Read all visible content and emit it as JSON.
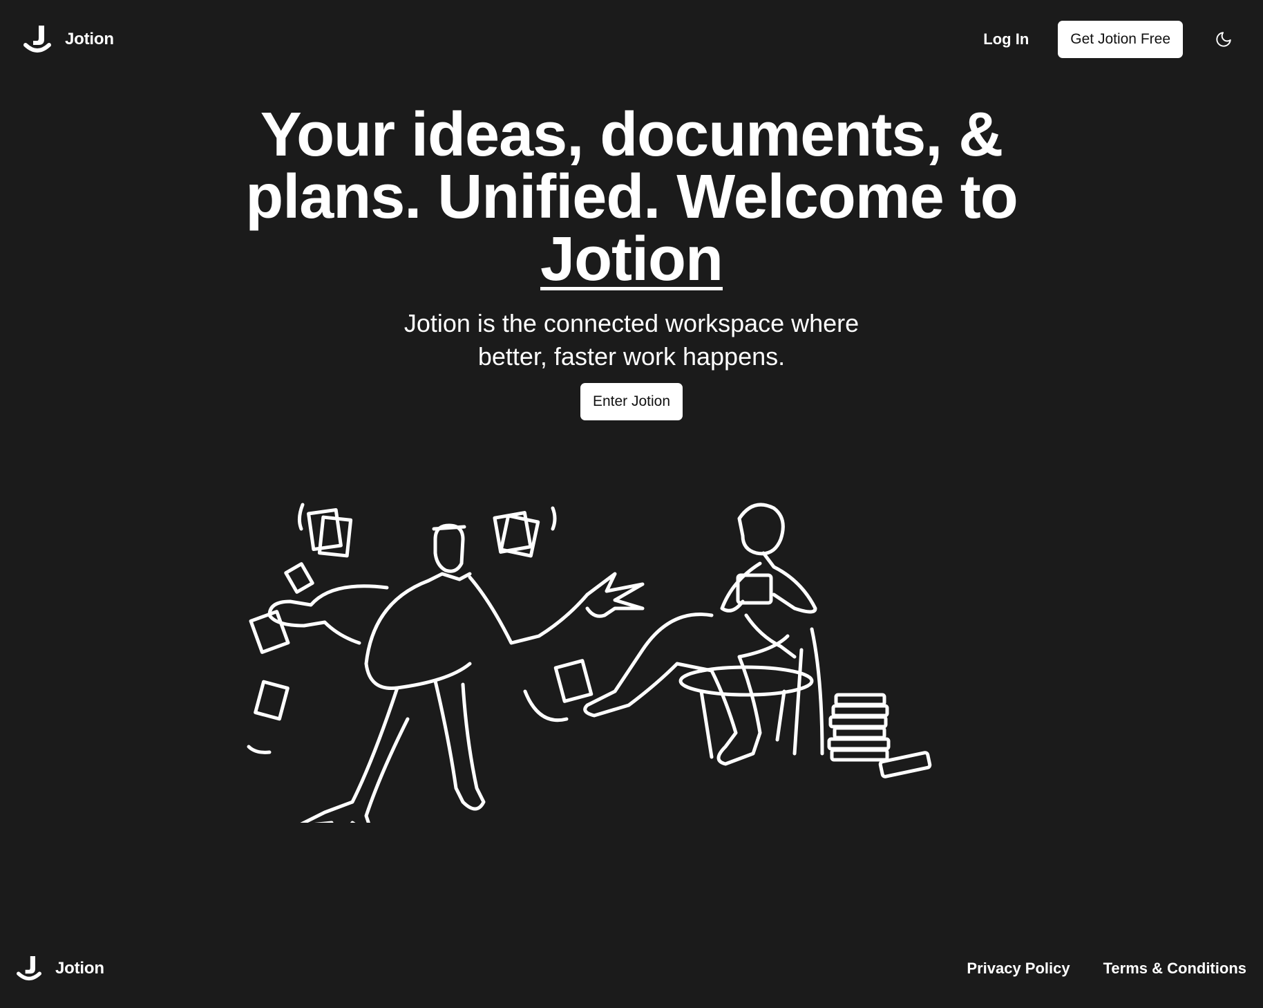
{
  "header": {
    "brand_name": "Jotion",
    "login_label": "Log In",
    "cta_label": "Get Jotion Free",
    "theme_icon": "moon-icon"
  },
  "hero": {
    "title_part1": "Your ideas, documents, & plans. Unified. Welcome to ",
    "title_brand": "Jotion",
    "subtitle": "Jotion is the connected workspace where better, faster work happens.",
    "enter_label": "Enter Jotion"
  },
  "illustration": {
    "figures": [
      "stressed-man-with-flying-papers",
      "woman-reading-on-chair-with-books"
    ]
  },
  "footer": {
    "brand_name": "Jotion",
    "links": [
      "Privacy Policy",
      "Terms & Conditions"
    ]
  },
  "colors": {
    "background": "#1b1b1b",
    "text": "#ffffff",
    "button_bg": "#ffffff",
    "button_text": "#111111"
  }
}
